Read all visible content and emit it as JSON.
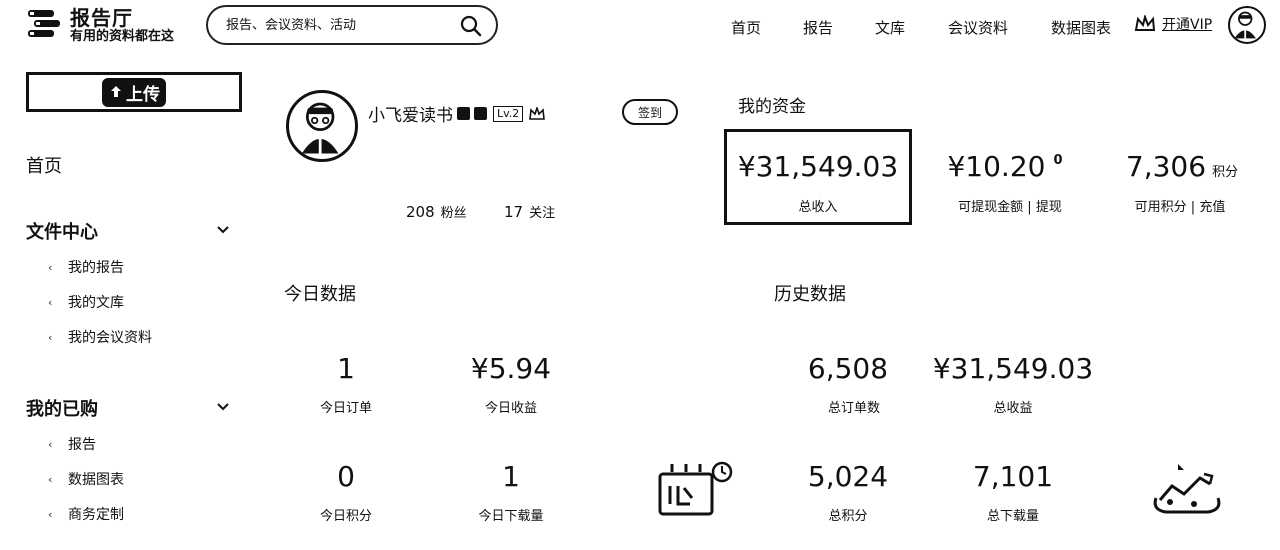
{
  "header": {
    "logo_title": "报告厅",
    "logo_slogan": "有用的资料都在这",
    "search_placeholder": "报告、会议资料、活动",
    "nav": [
      "首页",
      "报告",
      "文库",
      "会议资料",
      "数据图表"
    ],
    "vip_label": "开通VIP"
  },
  "sidebar": {
    "upload_label": "上传",
    "home": "首页",
    "files_center": "文件中心",
    "files_items": [
      "我的报告",
      "我的文库",
      "我的会议资料"
    ],
    "purchased": "我的已购",
    "purchased_items": [
      "报告",
      "数据图表",
      "商务定制"
    ]
  },
  "profile": {
    "name": "小飞爱读书",
    "level": "Lv.2",
    "signin_label": "签到",
    "fans_count": "208",
    "fans_label": "粉丝",
    "follow_count": "17",
    "follow_label": "关注"
  },
  "funds": {
    "title": "我的资金",
    "total_income_value": "¥31,549.03",
    "total_income_label": "总收入",
    "withdrawable_value": "¥10.20",
    "withdrawable_info": "0",
    "withdrawable_label": "可提现金额 | 提现",
    "points_value": "7,306",
    "points_unit": "积分",
    "points_label": "可用积分 | 充值"
  },
  "today": {
    "title": "今日数据",
    "orders_value": "1",
    "orders_label": "今日订单",
    "income_value": "¥5.94",
    "income_label": "今日收益",
    "points_value": "0",
    "points_label": "今日积分",
    "downloads_value": "1",
    "downloads_label": "今日下载量"
  },
  "history": {
    "title": "历史数据",
    "orders_value": "6,508",
    "orders_label": "总订单数",
    "income_value": "¥31,549.03",
    "income_label": "总收益",
    "points_value": "5,024",
    "points_label": "总积分",
    "downloads_value": "7,101",
    "downloads_label": "总下载量"
  },
  "colors": {
    "ink": "#111111",
    "background": "#ffffff"
  },
  "icons": [
    "logo-icon",
    "search-icon",
    "vip-crown-icon",
    "user-avatar",
    "upload-icon",
    "chevron-down-icon",
    "bullet-icon",
    "level-badge-icon",
    "calendar-illustration",
    "chart-illustration"
  ]
}
